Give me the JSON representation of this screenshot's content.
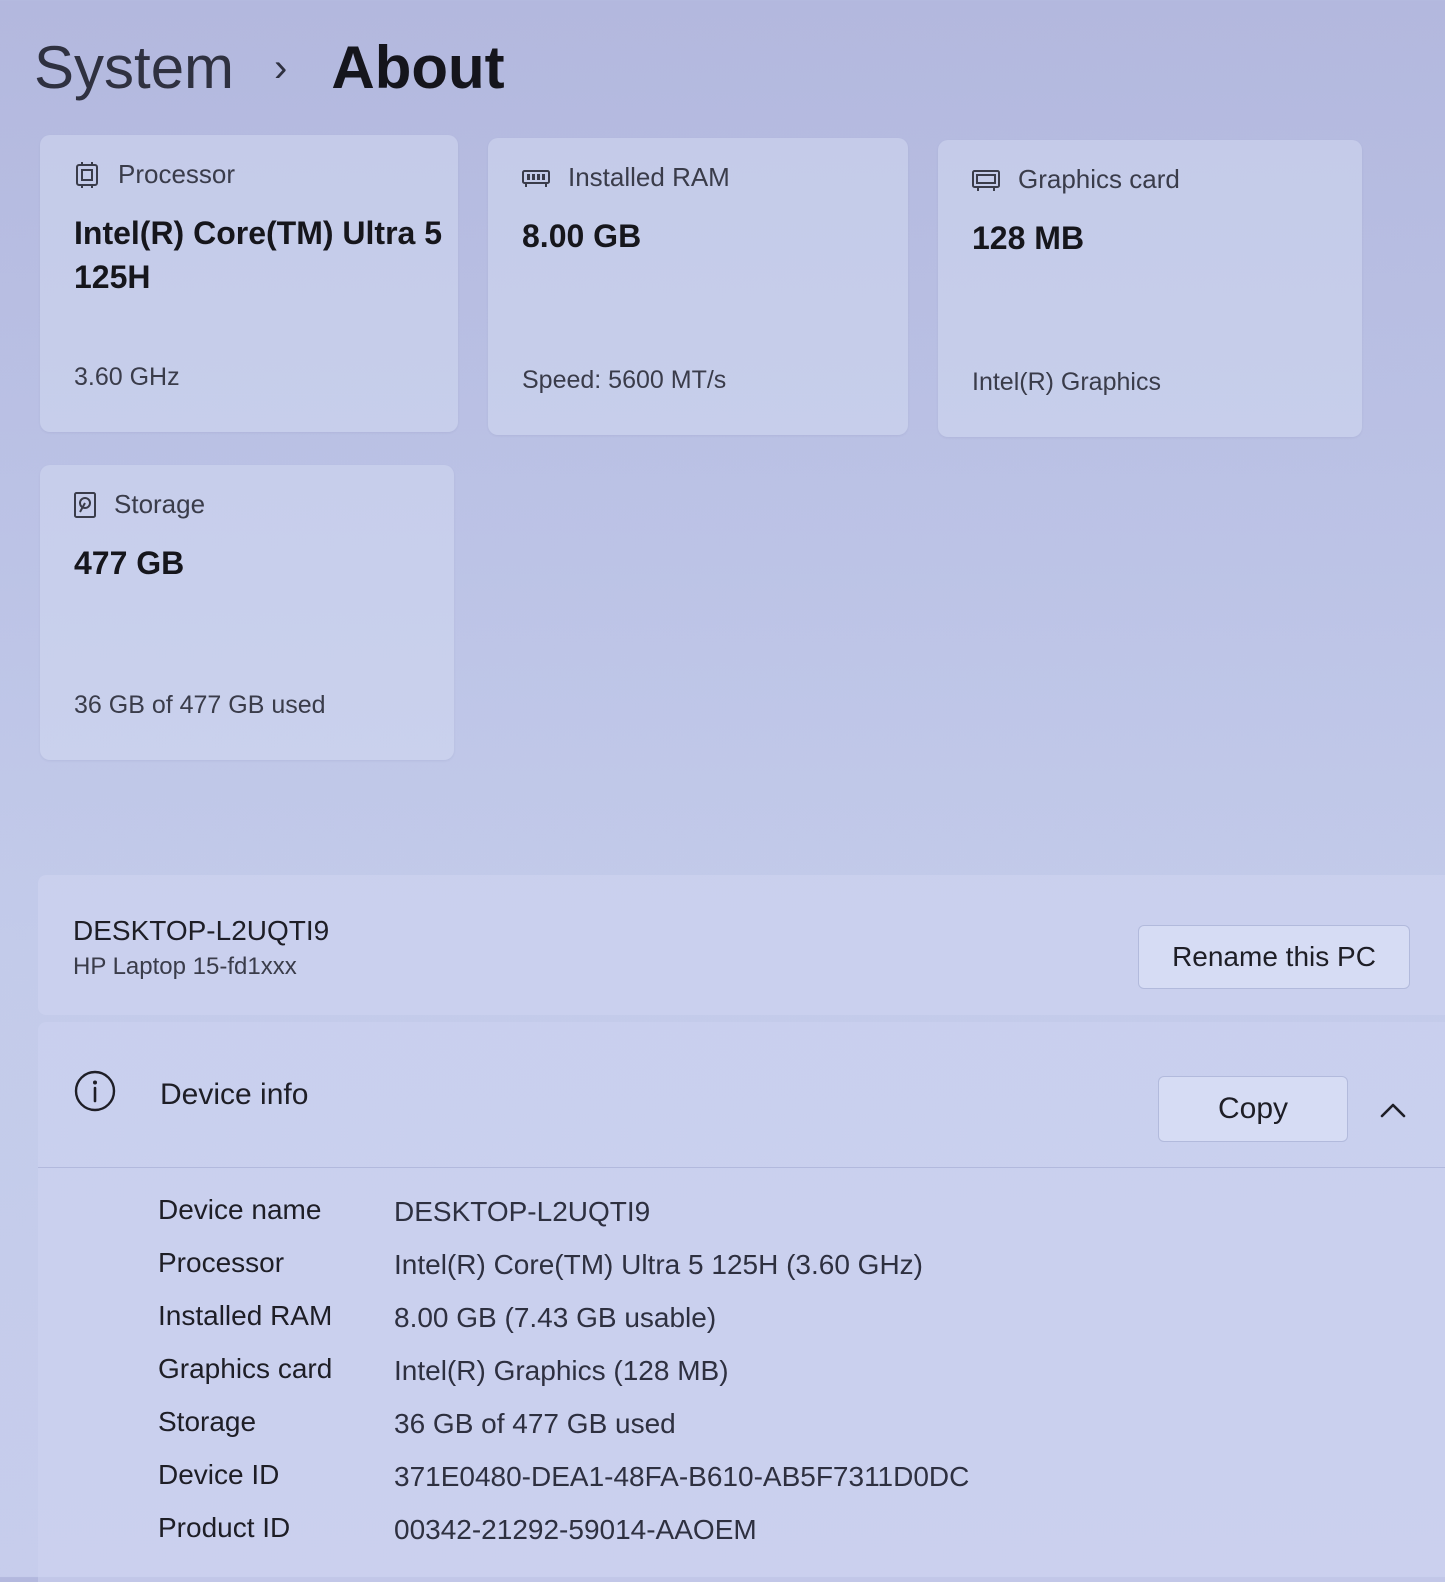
{
  "breadcrumb": {
    "parent": "System",
    "separator": "›",
    "current": "About"
  },
  "specs_cards": [
    {
      "icon": "processor-icon",
      "label": "Processor",
      "value": "Intel(R) Core(TM) Ultra 5 125H",
      "sub": "3.60 GHz"
    },
    {
      "icon": "ram-icon",
      "label": "Installed RAM",
      "value": "8.00 GB",
      "sub": "Speed: 5600 MT/s"
    },
    {
      "icon": "graphics-card-icon",
      "label": "Graphics card",
      "value": "128 MB",
      "sub": "Intel(R) Graphics"
    },
    {
      "icon": "storage-icon",
      "label": "Storage",
      "value": "477 GB",
      "sub": "36 GB of 477 GB used"
    }
  ],
  "pc": {
    "name": "DESKTOP-L2UQTI9",
    "model": "HP Laptop 15-fd1xxx",
    "rename_label": "Rename this PC"
  },
  "device_info": {
    "title": "Device info",
    "copy_label": "Copy",
    "rows": [
      {
        "label": "Device name",
        "value": "DESKTOP-L2UQTI9"
      },
      {
        "label": "Processor",
        "value": "Intel(R) Core(TM) Ultra 5 125H (3.60 GHz)"
      },
      {
        "label": "Installed RAM",
        "value": "8.00 GB (7.43 GB usable)"
      },
      {
        "label": "Graphics card",
        "value": "Intel(R) Graphics (128 MB)"
      },
      {
        "label": "Storage",
        "value": "36 GB of 477 GB used"
      },
      {
        "label": "Device ID",
        "value": "371E0480-DEA1-48FA-B610-AB5F7311D0DC"
      },
      {
        "label": "Product ID",
        "value": "00342-21292-59014-AAOEM"
      }
    ]
  }
}
